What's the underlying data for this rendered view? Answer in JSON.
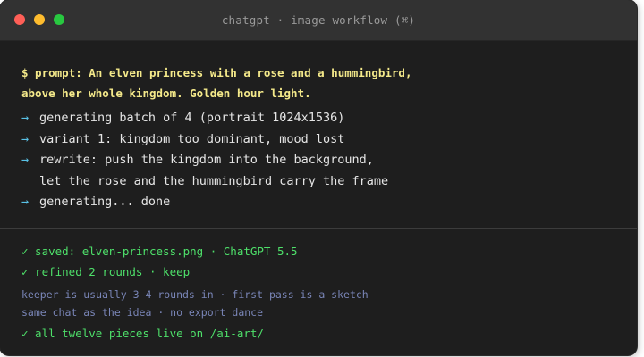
{
  "window": {
    "title": "chatgpt · image workflow (⌘)"
  },
  "terminal": {
    "prompt_lines": [
      "$ prompt: An elven princess with a rose and a hummingbird,",
      "above her whole kingdom. Golden hour light."
    ],
    "arrow_glyph": "→",
    "steps": [
      {
        "lines": [
          "generating batch of 4 (portrait 1024x1536)"
        ]
      },
      {
        "lines": [
          "variant 1: kingdom too dominant, mood lost"
        ]
      },
      {
        "lines": [
          "rewrite: push the kingdom into the background,",
          "let the rose and the hummingbird carry the frame"
        ]
      },
      {
        "lines": [
          "generating... done"
        ]
      }
    ],
    "results": [
      "✓ saved: elven-princess.png · ChatGPT 5.5",
      "✓ refined 2 rounds · keep"
    ],
    "notes": [
      "keeper is usually 3–4 rounds in · first pass is a sketch",
      "same chat as the idea · no export dance"
    ],
    "final": "✓ all twelve pieces live on /ai-art/"
  },
  "colors": {
    "background": "#1e1e1e",
    "titlebar": "#323232",
    "prompt": "#f4e98a",
    "arrow": "#59c2e6",
    "success": "#4ee06a",
    "note": "#7a86b8"
  }
}
